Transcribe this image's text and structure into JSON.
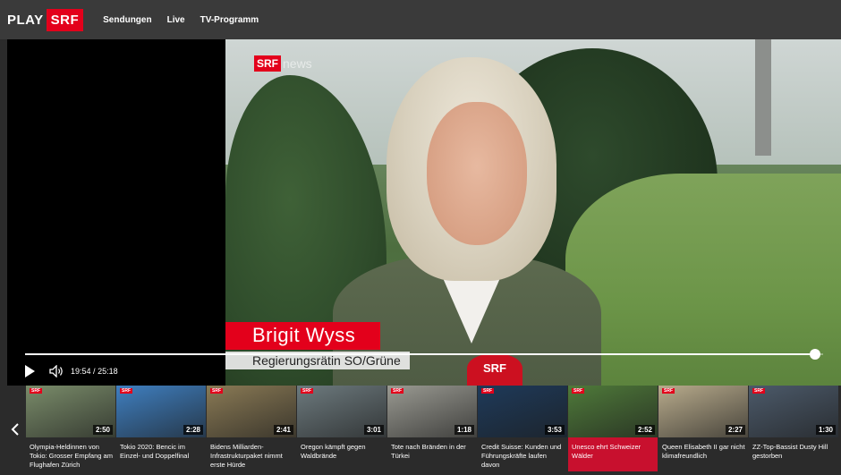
{
  "logo": {
    "play": "PLAY",
    "srf": "SRF"
  },
  "nav": [
    {
      "label": "Sendungen"
    },
    {
      "label": "Live"
    },
    {
      "label": "TV-Programm"
    }
  ],
  "player": {
    "channel_bug": {
      "srf": "SRF",
      "news": "news"
    },
    "lower_third": {
      "name": "Brigit Wyss",
      "role": "Regierungsrätin SO/Grüne"
    },
    "mic_label": "SRF",
    "time_current": "19:54",
    "time_separator": "/",
    "time_total": "25:18",
    "progress_fraction": 0.99
  },
  "carousel": {
    "items": [
      {
        "title": "Olympia-Heldinnen von Tokio: Grosser Empfang am Flughafen Zürich",
        "duration": "2:50",
        "thumb_color": "#7a8c6a",
        "active": false
      },
      {
        "title": "Tokio 2020: Bencic im Einzel- und Doppelfinal",
        "duration": "2:28",
        "thumb_color": "#3f7fc0",
        "active": false
      },
      {
        "title": "Bidens Milliarden-Infrastrukturpaket nimmt erste Hürde",
        "duration": "2:41",
        "thumb_color": "#8a7a55",
        "active": false
      },
      {
        "title": "Oregon kämpft gegen Waldbrände",
        "duration": "3:01",
        "thumb_color": "#6d7a7e",
        "active": false
      },
      {
        "title": "Tote nach Bränden in der Türkei",
        "duration": "1:18",
        "thumb_color": "#9a9a92",
        "active": false
      },
      {
        "title": "Credit Suisse: Kunden und Führungskräfte laufen davon",
        "duration": "3:53",
        "thumb_color": "#1e3a5a",
        "active": false
      },
      {
        "title": "Unesco ehrt Schweizer Wälder",
        "duration": "2:52",
        "thumb_color": "#4f7a3a",
        "active": true
      },
      {
        "title": "Queen Elisabeth II gar nicht klimafreundlich",
        "duration": "2:27",
        "thumb_color": "#b8ab8c",
        "active": false
      },
      {
        "title": "ZZ-Top-Bassist Dusty Hill gestorben",
        "duration": "1:30",
        "thumb_color": "#4c5a6a",
        "active": false
      }
    ]
  }
}
